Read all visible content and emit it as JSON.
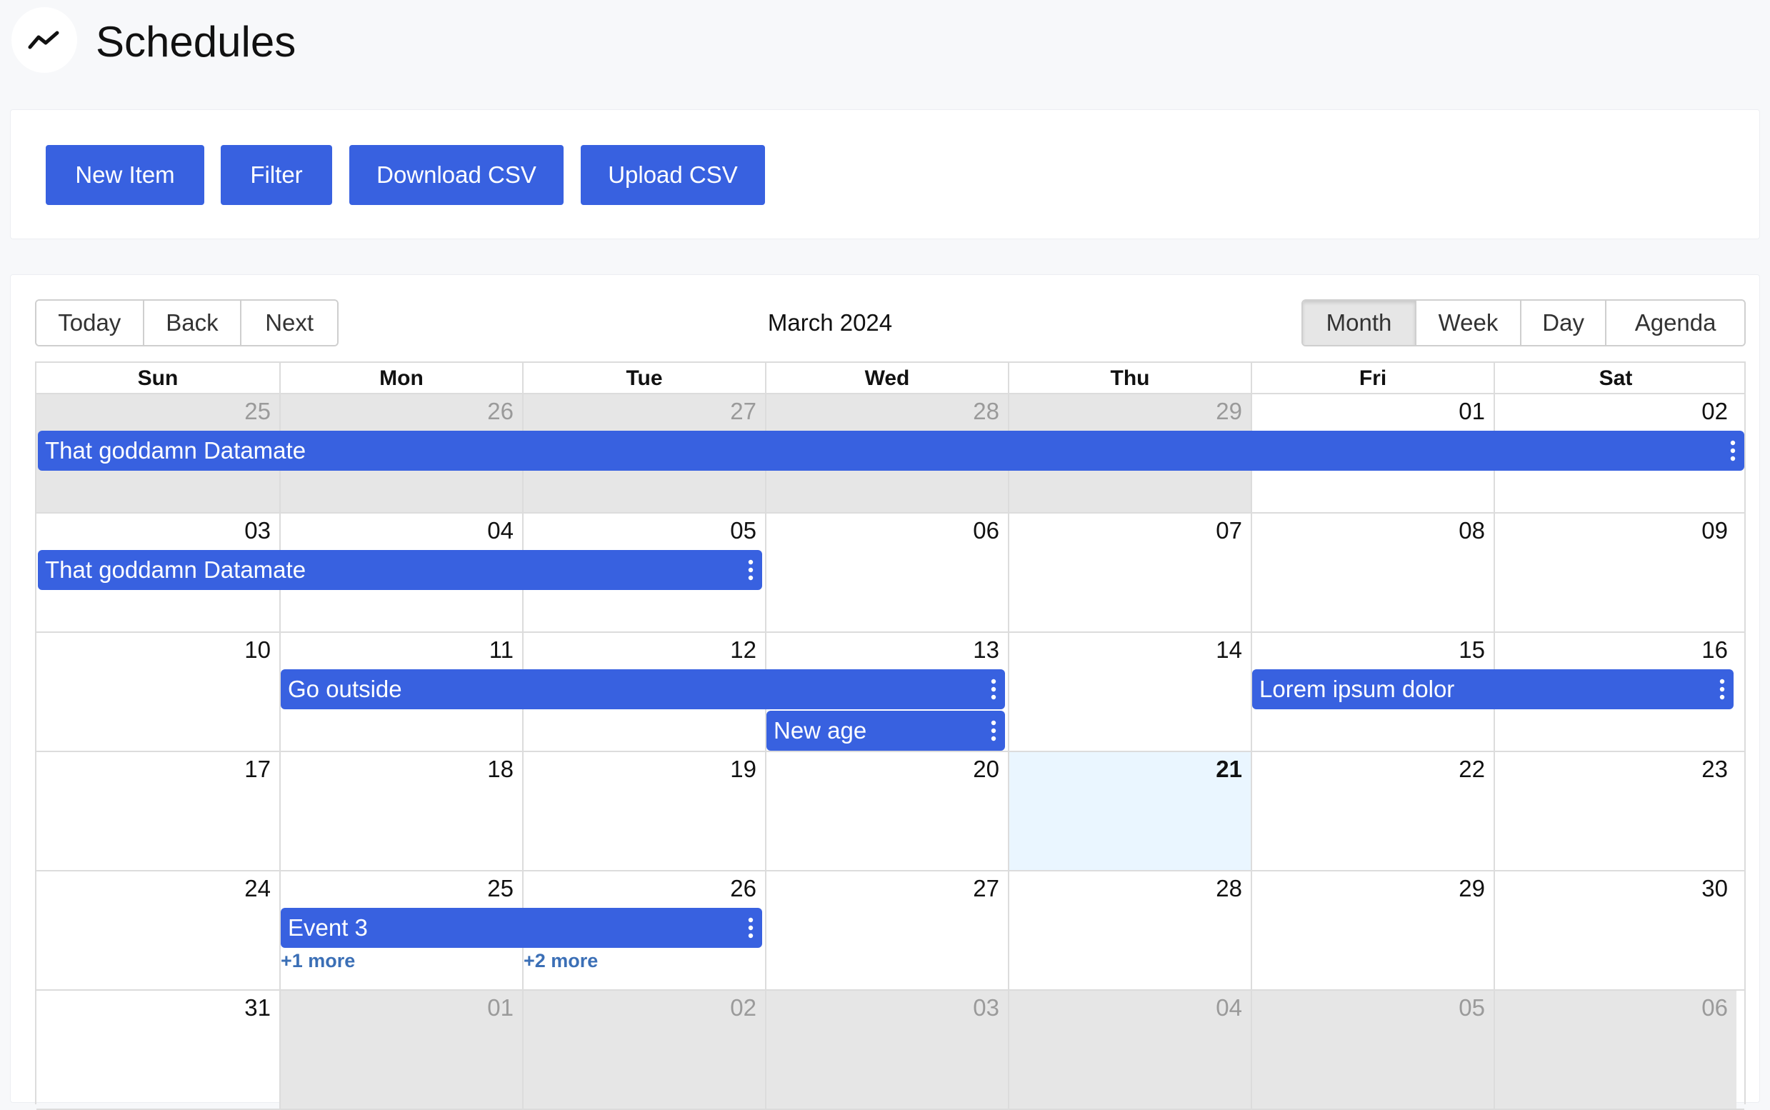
{
  "header": {
    "title": "Schedules",
    "logo_icon": "trend-line-icon"
  },
  "toolbar": {
    "new_item": "New Item",
    "filter": "Filter",
    "download_csv": "Download CSV",
    "upload_csv": "Upload CSV"
  },
  "calendar": {
    "nav": {
      "today": "Today",
      "back": "Back",
      "next": "Next"
    },
    "label": "March 2024",
    "views": {
      "month": "Month",
      "week": "Week",
      "day": "Day",
      "agenda": "Agenda",
      "active": "Month"
    },
    "weekdays": [
      "Sun",
      "Mon",
      "Tue",
      "Wed",
      "Thu",
      "Fri",
      "Sat"
    ],
    "weeks": [
      {
        "dates": [
          "25",
          "26",
          "27",
          "28",
          "29",
          "01",
          "02"
        ],
        "off": [
          true,
          true,
          true,
          true,
          true,
          false,
          false
        ]
      },
      {
        "dates": [
          "03",
          "04",
          "05",
          "06",
          "07",
          "08",
          "09"
        ],
        "off": [
          false,
          false,
          false,
          false,
          false,
          false,
          false
        ]
      },
      {
        "dates": [
          "10",
          "11",
          "12",
          "13",
          "14",
          "15",
          "16"
        ],
        "off": [
          false,
          false,
          false,
          false,
          false,
          false,
          false
        ]
      },
      {
        "dates": [
          "17",
          "18",
          "19",
          "20",
          "21",
          "22",
          "23"
        ],
        "off": [
          false,
          false,
          false,
          false,
          false,
          false,
          false
        ]
      },
      {
        "dates": [
          "24",
          "25",
          "26",
          "27",
          "28",
          "29",
          "30"
        ],
        "off": [
          false,
          false,
          false,
          false,
          false,
          false,
          false
        ]
      },
      {
        "dates": [
          "31",
          "01",
          "02",
          "03",
          "04",
          "05",
          "06"
        ],
        "off": [
          false,
          true,
          true,
          true,
          true,
          true,
          true
        ]
      }
    ],
    "today": "21",
    "events": [
      {
        "title": "That goddamn Datamate"
      },
      {
        "title": "That goddamn Datamate"
      },
      {
        "title": "Go outside"
      },
      {
        "title": "Lorem ipsum dolor"
      },
      {
        "title": "New age"
      },
      {
        "title": "Event 3"
      }
    ],
    "more_links": [
      "+1 more",
      "+2 more"
    ]
  },
  "colors": {
    "accent": "#3861e0",
    "today_bg": "#eaf6ff",
    "off_bg": "#e6e6e6",
    "more_link": "#3b6fb6"
  }
}
